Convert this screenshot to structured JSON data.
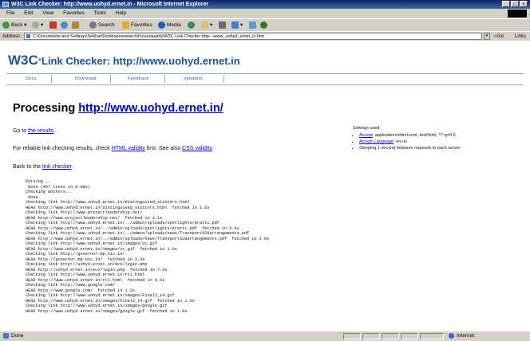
{
  "window": {
    "title": "W3C Link Checker: http://www.uohyd.ernet.in - Microsoft Internet Explorer"
  },
  "menu": [
    "File",
    "Edit",
    "View",
    "Favorites",
    "Tools",
    "Help"
  ],
  "toolbar": {
    "back": "Back",
    "search": "Search",
    "favorites": "Favorites",
    "media": "Media"
  },
  "address": {
    "label": "Address",
    "value": "C:\\Documents and Settings\\Sekhar\\Desktop\\research\\h\\cue\\quality\\W3C Link Checker http---www_uohyd_ernet_in.htm",
    "go": "Go",
    "links": "Links"
  },
  "header": {
    "logo": "W3C",
    "logo_mark": "®",
    "title": "Link Checker: http://www.uohyd.ernet.in",
    "nav": [
      "Docs",
      "Download",
      "Feedback",
      "Validator"
    ]
  },
  "main": {
    "processing_label": "Processing",
    "processing_url": "http://www.uohyd.ernet.in/",
    "goto_pre": "Go to ",
    "goto_link": "the results",
    "goto_post": ".",
    "reliable_pre": "For reliable link checking results, check ",
    "html_validity": "HTML validity",
    "reliable_mid": " first. See also ",
    "css_validity": "CSS validity",
    "reliable_post": ".",
    "back_pre": "Back to the ",
    "back_link": "link checker",
    "back_post": "."
  },
  "settings": {
    "title": "Settings used:",
    "accept_label": "Accept",
    "accept_value": ": application/xhtml+xml, text/html, */*;q=0.5",
    "accept_lang_label": "Accept-Language",
    "accept_lang_value": ": en-us",
    "sleeping": "Sleeping 1 second between requests to each server"
  },
  "log": [
    "Parsing...",
    " done (497 lines in 0.08s).",
    "Checking anchors...",
    " done.",
    "Checking link http://www.uohyd.ernet.in/distinguised_visitors.html",
    "HEAD http://www.uohyd.ernet.in/distinguised_visitors.html  fetched in 1.6s",
    "Checking link http://www.projectleadership.net/",
    "HEAD http://www.projectleadership.net/  fetched in 1.1s",
    "Checking link http://www.uohyd.ernet.in/../admin/uploads/spotlights/pratt1.pdf",
    "HEAD http://www.uohyd.ernet.in/../admin/uploads/spotlights/pratt1.pdf  fetched in 0.6s",
    "Checking link http://www.uohyd.ernet.in/../admin/uploads/news/Transport%20arrangements.pdf",
    "HEAD http://www.uohyd.ernet.in/../admin/uploads/news/Transport%20arrangements.pdf  fetched in 1.6s",
    "Checking link http://www.uohyd.ernet.in/images/vc.gif",
    "HEAD http://www.uohyd.ernet.in/images/vc.gif  fetched in 1.6s",
    "Checking link http://governor.mp.nic.in/",
    "HEAD http://governor.mp.nic.in/  fetched in 2.3s",
    "Checking link http://uohyd.ernet.in/eco/login.php",
    "HEAD http://uohyd.ernet.in/eco/login.php  fetched in 7.5s",
    "Checking link http://www.uohyd.ernet.in/rti.html",
    "HEAD http://www.uohyd.ernet.in/rti.html  fetched in 0.6s",
    "Checking link http://www.google.com/",
    "HEAD http://www.google.com/  fetched in 1.2s",
    "Checking link http://www.uohyd.ernet.in/images/Final2_14.gif",
    "HEAD http://www.uohyd.ernet.in/images/Final2_14.gif  fetched in 1.5s",
    "Checking link http://www.uohyd.ernet.in/images/google.gif",
    "HEAD http://www.uohyd.ernet.in/images/google.gif  fetched in 1.6s"
  ],
  "status": {
    "done": "Done",
    "zone": "Internet"
  }
}
